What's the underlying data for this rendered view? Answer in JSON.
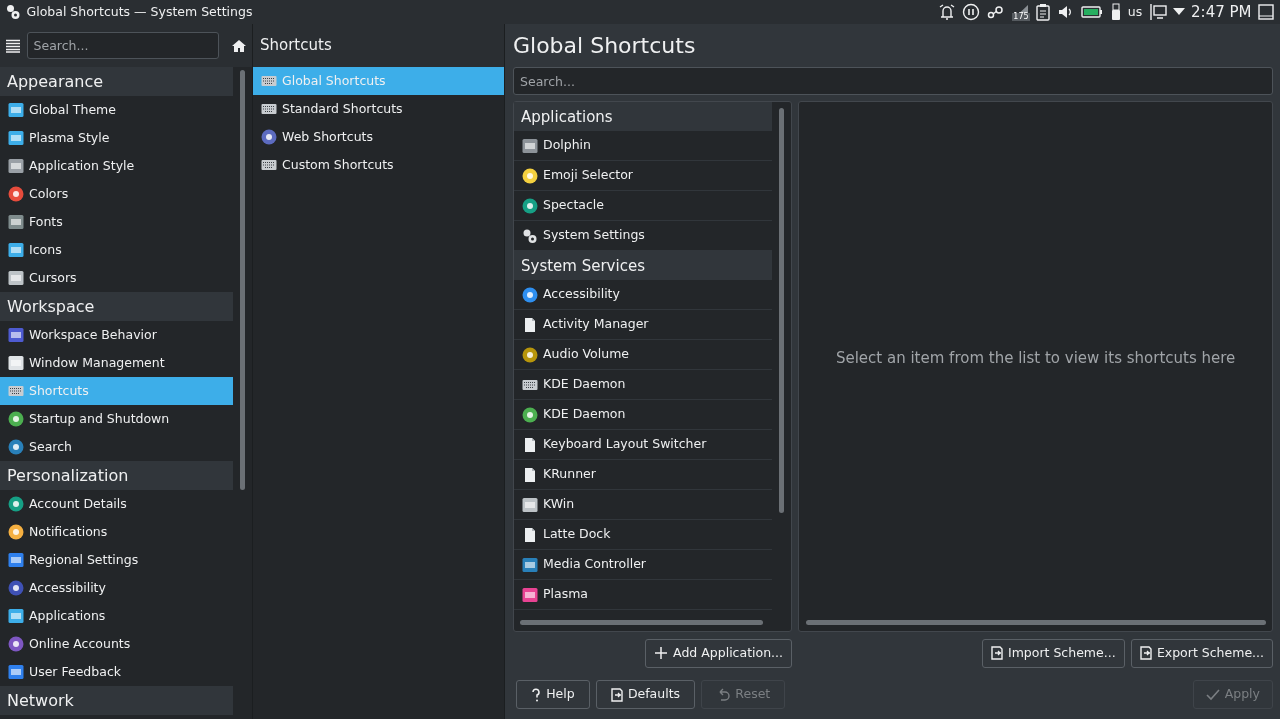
{
  "window": {
    "title": "Global Shortcuts  — System Settings"
  },
  "tray": {
    "badge": "175",
    "keyboard_layout": "us",
    "clock": "2:47 PM"
  },
  "sidebar": {
    "search": {
      "placeholder": "Search..."
    },
    "sections": [
      {
        "label": "Appearance",
        "items": [
          {
            "label": "Global Theme",
            "selected": false
          },
          {
            "label": "Plasma Style",
            "selected": false
          },
          {
            "label": "Application Style",
            "selected": false
          },
          {
            "label": "Colors",
            "selected": false
          },
          {
            "label": "Fonts",
            "selected": false
          },
          {
            "label": "Icons",
            "selected": false
          },
          {
            "label": "Cursors",
            "selected": false
          }
        ]
      },
      {
        "label": "Workspace",
        "items": [
          {
            "label": "Workspace Behavior",
            "selected": false
          },
          {
            "label": "Window Management",
            "selected": false
          },
          {
            "label": "Shortcuts",
            "selected": true
          },
          {
            "label": "Startup and Shutdown",
            "selected": false
          },
          {
            "label": "Search",
            "selected": false
          }
        ]
      },
      {
        "label": "Personalization",
        "items": [
          {
            "label": "Account Details",
            "selected": false
          },
          {
            "label": "Notifications",
            "selected": false
          },
          {
            "label": "Regional Settings",
            "selected": false
          },
          {
            "label": "Accessibility",
            "selected": false
          },
          {
            "label": "Applications",
            "selected": false
          },
          {
            "label": "Online Accounts",
            "selected": false
          },
          {
            "label": "User Feedback",
            "selected": false
          }
        ]
      },
      {
        "label": "Network"
      }
    ]
  },
  "subcategories": {
    "title": "Shortcuts",
    "items": [
      {
        "label": "Global Shortcuts",
        "selected": true
      },
      {
        "label": "Standard Shortcuts",
        "selected": false
      },
      {
        "label": "Web Shortcuts",
        "selected": false
      },
      {
        "label": "Custom Shortcuts",
        "selected": false
      }
    ]
  },
  "page": {
    "title": "Global Shortcuts",
    "search": {
      "placeholder": "Search..."
    },
    "groups": [
      {
        "label": "Applications",
        "items": [
          "Dolphin",
          "Emoji Selector",
          "Spectacle",
          "System Settings"
        ]
      },
      {
        "label": "System Services",
        "items": [
          "Accessibility",
          "Activity Manager",
          "Audio Volume",
          "KDE Daemon",
          "KDE Daemon",
          "Keyboard Layout Switcher",
          "KRunner",
          "KWin",
          "Latte Dock",
          "Media Controller",
          "Plasma"
        ]
      }
    ],
    "detail_hint": "Select an item from the list to view its shortcuts here",
    "list_buttons": [
      {
        "label": "Add Application...",
        "disabled": false
      }
    ],
    "scheme_buttons": [
      {
        "label": "Import Scheme...",
        "disabled": false
      },
      {
        "label": "Export Scheme...",
        "disabled": false
      }
    ],
    "footer_buttons": [
      {
        "label": "Help",
        "disabled": false
      },
      {
        "label": "Defaults",
        "disabled": false
      },
      {
        "label": "Reset",
        "disabled": true
      }
    ],
    "apply_button": {
      "label": "Apply",
      "disabled": true
    }
  }
}
